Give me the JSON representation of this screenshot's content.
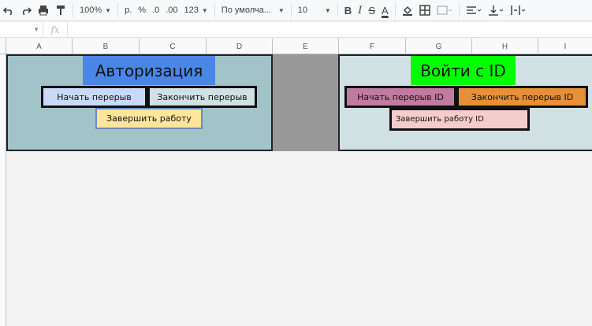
{
  "toolbar": {
    "zoom": "100%",
    "currency": "р.",
    "percent": "%",
    "dec_decrease": ".0",
    "dec_increase": ".00",
    "format_more": "123",
    "font_name": "По умолча...",
    "font_size": "10",
    "bold": "B",
    "italic": "I",
    "strike": "S",
    "text_color": "A"
  },
  "formula_bar": {
    "fx": "fx"
  },
  "columns": [
    "A",
    "B",
    "C",
    "D",
    "E",
    "F",
    "G",
    "H",
    "I"
  ],
  "left_panel": {
    "title": "Авторизация",
    "title_color": "#4a86e8",
    "bg_color": "#a2c4c9",
    "buttons": [
      {
        "label": "Начать перерыв",
        "color": "#c9daf8"
      },
      {
        "label": "Закончить перерыв",
        "color": "#d0e0e3"
      },
      {
        "label": "Завершить работу",
        "color": "#ffe599"
      }
    ]
  },
  "right_panel": {
    "title": "Войти с ID",
    "title_color": "#00ff00",
    "bg_color": "#d0e0e3",
    "buttons": [
      {
        "label": "Начать перерыв ID",
        "color": "#c27ba0"
      },
      {
        "label": "Закончить перерыв ID",
        "color": "#e69138"
      },
      {
        "label": "Завершить работу ID",
        "color": "#f4cccc"
      }
    ]
  },
  "separator_color": "#999999"
}
